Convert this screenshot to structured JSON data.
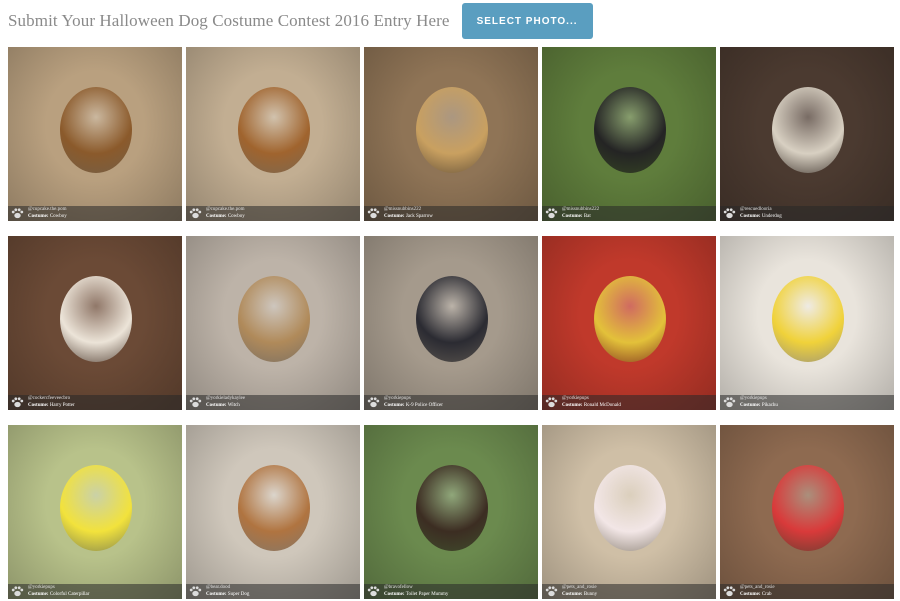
{
  "header": {
    "title": "Submit Your Halloween Dog Costume Contest 2016 Entry Here",
    "select_button": "SELECT PHOTO..."
  },
  "costume_label": "Costume:",
  "entries": [
    {
      "user": "@cupcake.the.pom",
      "costume": "Cowboy",
      "bg": "#b9a07f",
      "fg": "#8b5a2b"
    },
    {
      "user": "@cupcake.the.pom",
      "costume": "Cowboy",
      "bg": "#c2ae92",
      "fg": "#a0642e"
    },
    {
      "user": "@missnubbins222",
      "costume": "Jack Sparrow",
      "bg": "#8f7456",
      "fg": "#c9a060"
    },
    {
      "user": "@missnubbins222",
      "costume": "Bat",
      "bg": "#5f7d3c",
      "fg": "#242424"
    },
    {
      "user": "@rescuedlooria",
      "costume": "Underdog",
      "bg": "#4b3a30",
      "fg": "#d8d0c2"
    },
    {
      "user": "@cockercfeeveecbro",
      "costume": "Harry Potter",
      "bg": "#6b4a36",
      "fg": "#ece4d8"
    },
    {
      "user": "@yorkieladykaylee",
      "costume": "Witch",
      "bg": "#bdb3a8",
      "fg": "#b08a5a"
    },
    {
      "user": "@yorkiepups",
      "costume": "K-9 Police Officer",
      "bg": "#a59a8c",
      "fg": "#2b2b32"
    },
    {
      "user": "@yorkiepups",
      "costume": "Ronald McDonald",
      "bg": "#c0392b",
      "fg": "#e3c13a"
    },
    {
      "user": "@yorkiepups",
      "costume": "Pikachu",
      "bg": "#e9e4dc",
      "fg": "#f0d23a"
    },
    {
      "user": "@yorkiepups",
      "costume": "Colorful Caterpillar",
      "bg": "#b8c28a",
      "fg": "#f2e23c"
    },
    {
      "user": "@bear.dood",
      "costume": "Super Dog",
      "bg": "#cfc7bb",
      "fg": "#b07440"
    },
    {
      "user": "@bravofellow",
      "costume": "Toilet Paper Mummy",
      "bg": "#6b8a4e",
      "fg": "#3c2d22"
    },
    {
      "user": "@pets_and_rosie",
      "costume": "Bunny",
      "bg": "#cfbfa6",
      "fg": "#f2e6e6"
    },
    {
      "user": "@pets_and_rosie",
      "costume": "Crab",
      "bg": "#8e6a50",
      "fg": "#d93a3a"
    }
  ]
}
